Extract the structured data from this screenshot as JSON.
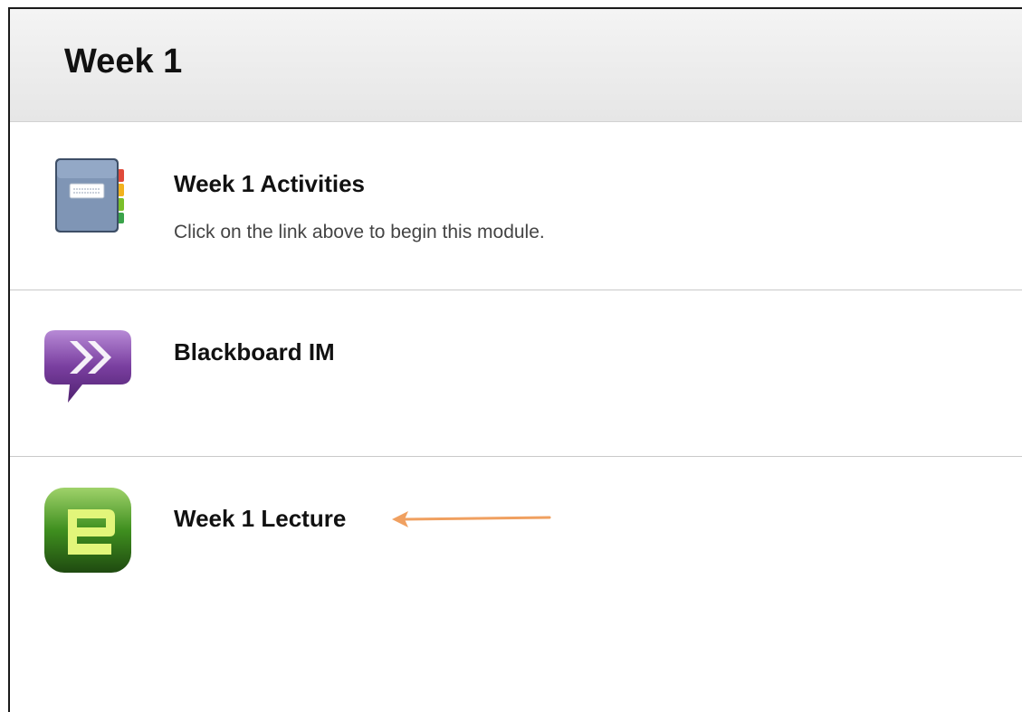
{
  "header": {
    "title": "Week 1"
  },
  "items": [
    {
      "title": "Week 1 Activities",
      "description": "Click on the link above to begin this module.",
      "icon": "module-notebook-icon"
    },
    {
      "title": "Blackboard IM",
      "icon": "blackboard-im-icon"
    },
    {
      "title": "Week 1 Lecture",
      "icon": "echo-lecture-icon"
    }
  ],
  "colors": {
    "annotation_arrow": "#f0a060",
    "im_purple": "#7a3fa0",
    "echo_green": "#3f8f1f"
  }
}
